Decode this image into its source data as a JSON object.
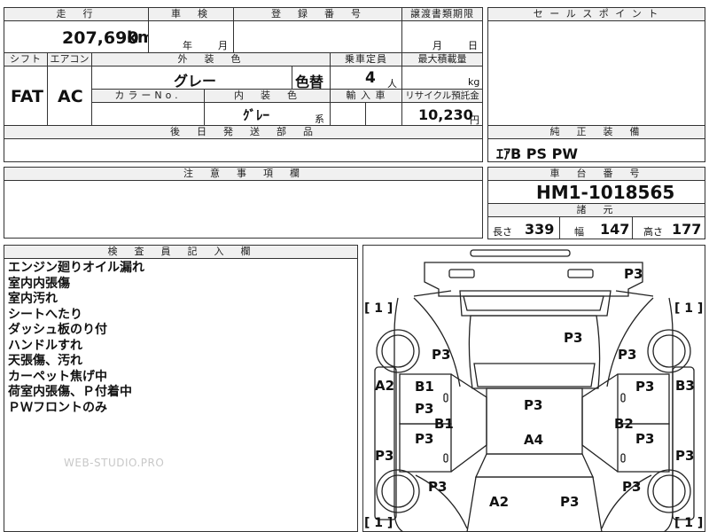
{
  "sheet": {
    "mileage_header": "走　行",
    "mileage_value": "207,690",
    "mileage_unit": "km",
    "inspection_header": "車　検",
    "inspection_year": "年",
    "inspection_month": "月",
    "registration_header": "登　録　番　号",
    "transfer_header": "譲渡書類期限",
    "transfer_month": "月",
    "transfer_day": "日",
    "shift_header": "シフト",
    "shift_value": "FAT",
    "ac_header": "エアコン",
    "ac_value": "AC",
    "exterior_header": "外　装　色",
    "exterior_value": "グレー",
    "color_change": "色替",
    "capacity_header": "乗車定員",
    "capacity_value": "4",
    "capacity_unit": "人",
    "max_load_header": "最大積載量",
    "max_load_unit": "kg",
    "color_no_header": "カラーNo.",
    "interior_header": "内　装　色",
    "interior_value": "ｸﾞﾚｰ",
    "interior_unit": "系",
    "import_header": "輸 入 車",
    "recycle_header": "リサイクル預託金",
    "recycle_value": "10,230",
    "recycle_unit": "円",
    "later_parts_header": "後　日　発　送　部　品",
    "notes_header": "注　意　事　項　欄",
    "sales_header": "セ ー ル ス ポ イ ン ト",
    "genuine_header": "純　正　装　備",
    "genuine_value": "ｴｱB PS PW",
    "chassis_header": "車　台　番　号",
    "chassis_value": "HM1-1018565",
    "specs_header": "諸　元",
    "length_label": "長さ",
    "length_value": "339",
    "width_label": "幅",
    "width_value": "147",
    "height_label": "高さ",
    "height_value": "177",
    "inspector_header": "検　査　員　記　入　欄"
  },
  "inspector_notes": [
    "エンジン廻りオイル漏れ",
    "室内内張傷",
    "室内汚れ",
    "シートへたり",
    "ダッシュ板のり付",
    "ハンドルすれ",
    "天張傷、汚れ",
    "カーペット焦げ中",
    "荷室内張傷、Ｐ付着中",
    "ＰＷフロントのみ"
  ],
  "watermark": "WEB-STUDIO.PRO",
  "diagram": {
    "tire_brackets": [
      "[ 1 ]",
      "[ 1 ]",
      "[ 1 ]",
      "[ 1 ]"
    ],
    "marks": {
      "rear_bumper": "P3",
      "roof": "P3",
      "left_quarter": "P3",
      "right_quarter": "P3",
      "left_rear_pillar": "A2",
      "right_rear_pillar": "B3",
      "left_rear_door_b": "B1",
      "left_rear_door_p": "P3",
      "right_rear_door": "P3",
      "center_roof": "P3",
      "left_pillar_b": "B1",
      "right_pillar_b": "B2",
      "left_front_door": "P3",
      "right_front_door": "P3",
      "hood": "A4",
      "left_rocker": "P3",
      "right_rocker": "P3",
      "left_front_fender": "P3",
      "right_front_fender": "P3",
      "front_left": "A2",
      "front_right": "P3"
    }
  }
}
